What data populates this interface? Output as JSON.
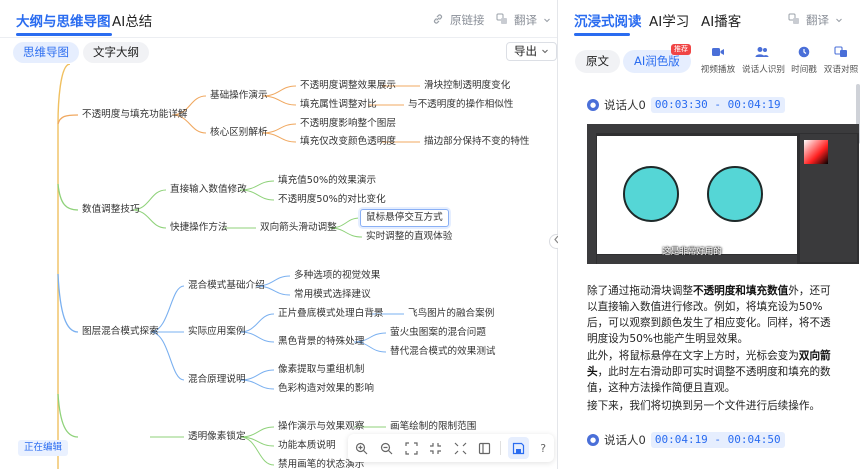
{
  "left_header": {
    "tabs": [
      {
        "label": "大纲与思维导图",
        "active": true
      },
      {
        "label": "AI总结",
        "active": false
      }
    ],
    "original_link_label": "原链接",
    "translate_label": "翻译"
  },
  "view_switch": {
    "mindmap_label": "思维导图",
    "outline_label": "文字大纲",
    "export_label": "导出"
  },
  "mindmap": {
    "nodes": {
      "b1": "不透明度与填充功能详解",
      "b1_1": "基础操作演示",
      "b1_1_1": "不透明度调整效果展示",
      "b1_1_1a": "滑块控制透明度变化",
      "b1_1_2": "填充属性调整对比",
      "b1_1_2a": "与不透明度的操作相似性",
      "b1_2": "核心区别解析",
      "b1_2_1": "不透明度影响整个图层",
      "b1_2_2": "填充仅改变颜色透明度",
      "b1_2_2a": "描边部分保持不变的特性",
      "b2": "数值调整技巧",
      "b2_1": "直接输入数值修改",
      "b2_1_1": "填充值50%的效果演示",
      "b2_1_2": "不透明度50%的对比变化",
      "b2_2": "快捷操作方法",
      "b2_2_1": "双向箭头滑动调整",
      "b2_2_1a": "鼠标悬停交互方式",
      "b2_2_1b": "实时调整的直观体验",
      "b3": "图层混合模式探索",
      "b3_1": "混合模式基础介绍",
      "b3_1_1": "多种选项的视觉效果",
      "b3_1_2": "常用模式选择建议",
      "b3_2": "实际应用案例",
      "b3_2_1": "正片叠底模式处理白背景",
      "b3_2_1a": "飞鸟图片的融合案例",
      "b3_2_2": "黑色背景的特殊处理",
      "b3_2_2a": "萤火虫图案的混合问题",
      "b3_2_2b": "替代混合模式的效果测试",
      "b3_3": "混合原理说明",
      "b3_3_1": "像素提取与重组机制",
      "b3_3_2": "色彩构造对效果的影响",
      "b4": "透明像素锁定",
      "b4_1": "操作演示与效果观察",
      "b4_1a": "画笔绘制的限制范围",
      "b4_2": "功能本质说明",
      "b4_3": "禁用画笔的状态演示"
    },
    "selected_node": "鼠标悬停交互方式",
    "colors": {
      "branch1": "#f0a860",
      "branch2": "#8fd27a",
      "branch3": "#7ab0f0",
      "branch4": "#8fd27a",
      "root": "#f0c060"
    }
  },
  "editing_badge": "正在编辑",
  "bottom_toolbar": {
    "icons": [
      "zoom-in-icon",
      "zoom-out-icon",
      "fit-screen-icon",
      "collapse-all-icon",
      "expand-all-icon",
      "sidebar-icon",
      "save-icon",
      "help-icon"
    ]
  },
  "right_header": {
    "tabs": [
      {
        "label": "沉浸式阅读",
        "active": true
      },
      {
        "label": "AI学习",
        "active": false
      },
      {
        "label": "AI播客",
        "active": false
      }
    ],
    "translate_label": "翻译"
  },
  "mode_bar": {
    "original_label": "原文",
    "polish_label": "AI润色版",
    "polish_badge": "推荐",
    "buttons": [
      {
        "label": "视频播放",
        "icon": "video-icon"
      },
      {
        "label": "说话人识别",
        "icon": "people-icon"
      },
      {
        "label": "时间戳",
        "icon": "clock-icon"
      },
      {
        "label": "双语对照",
        "icon": "bilingual-icon"
      }
    ]
  },
  "transcript": {
    "segment1": {
      "speaker": "说话人0",
      "time": "00:03:30 - 00:04:19"
    },
    "video_caption": "这是非常好用的",
    "paragraphs": {
      "p1_a": "除了通过拖动滑块调整",
      "p1_b": "不透明度和填充数值",
      "p1_c": "外，还可以直接输入数值进行修改。例如，将填充设为50%后，可以观察到颜色发生了相应变化。同样，将不透明度设为50%也能产生明显效果。",
      "p2_a": "此外，将鼠标悬停在文字上方时，光标会变为",
      "p2_b": "双向箭头",
      "p2_c": "，此时左右滑动即可实时调整不透明度和填充的数值，这种方法操作简便且直观。",
      "p3": "接下来，我们将切换到另一个文件进行后续操作。"
    },
    "segment2": {
      "speaker": "说话人0",
      "time": "00:04:19 - 00:04:50"
    }
  }
}
